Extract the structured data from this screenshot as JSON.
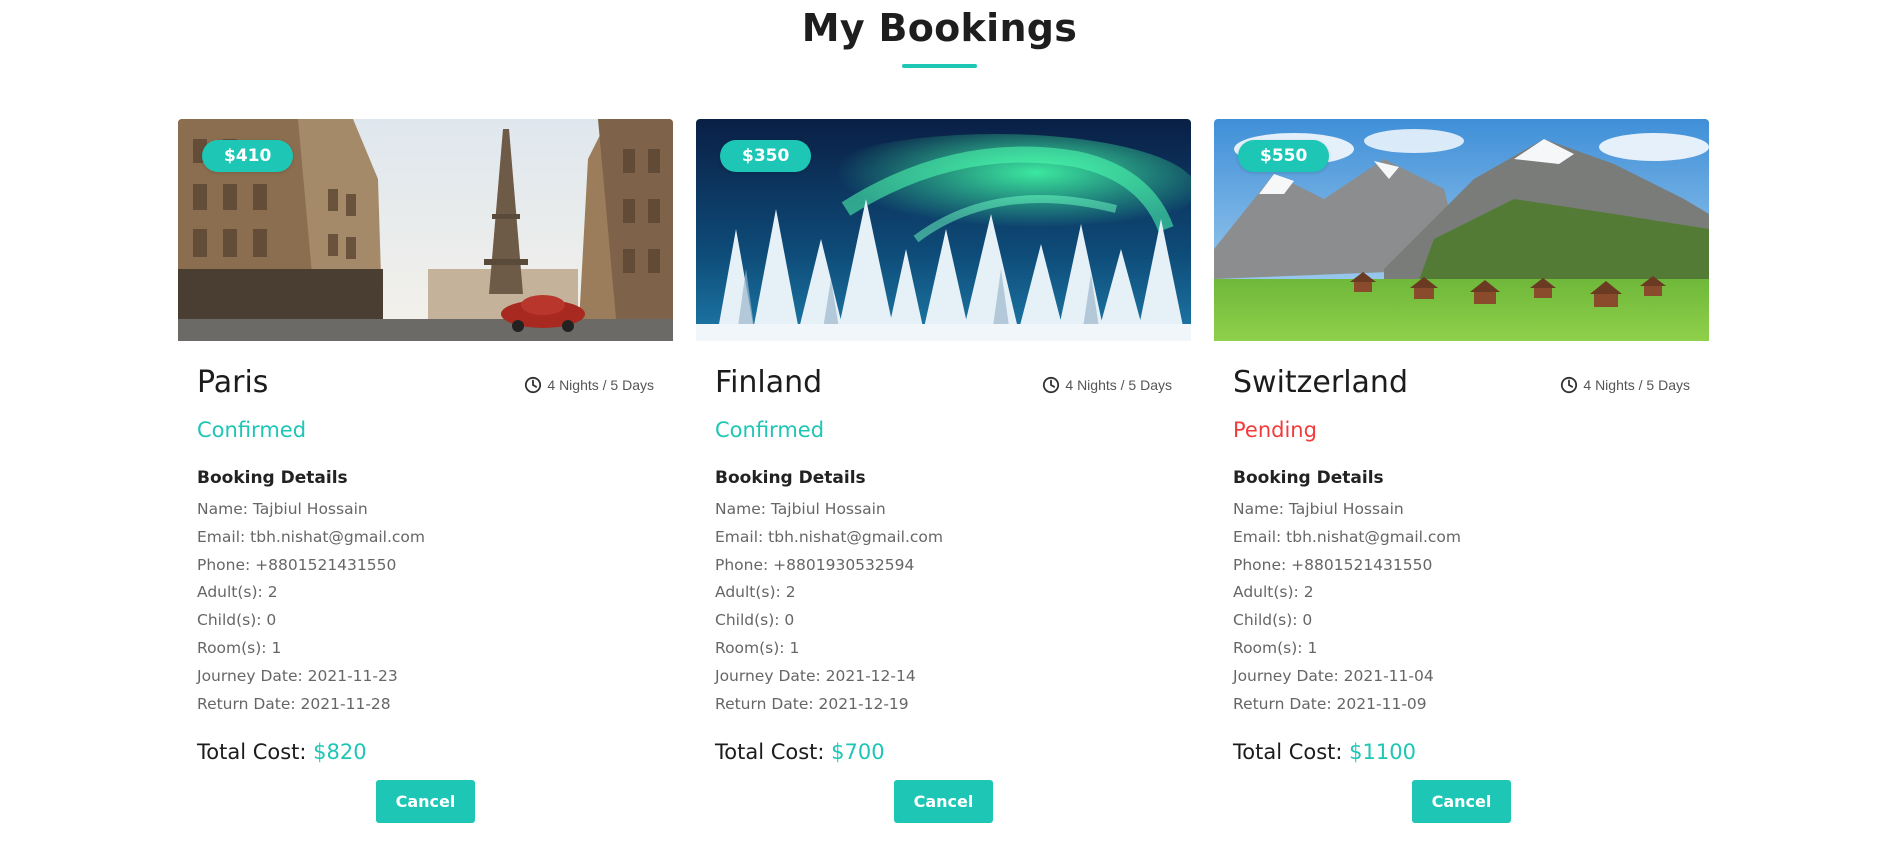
{
  "page": {
    "title": "My Bookings"
  },
  "colors": {
    "accent": "#1ec6b6",
    "pending": "#f23b3b"
  },
  "bookings": [
    {
      "price": "$410",
      "destination": "Paris",
      "duration": "4 Nights / 5 Days",
      "status": "Confirmed",
      "details_heading": "Booking Details",
      "name": "Name: Tajbiul Hossain",
      "email": "Email: tbh.nishat@gmail.com",
      "phone": "Phone: +8801521431550",
      "adults": "Adult(s): 2",
      "children": "Child(s): 0",
      "rooms": "Room(s): 1",
      "journey": "Journey Date: 2021-11-23",
      "return": "Return Date: 2021-11-28",
      "total_label": "Total Cost:",
      "total_value": "$820",
      "cancel_label": "Cancel"
    },
    {
      "price": "$350",
      "destination": "Finland",
      "duration": "4 Nights / 5 Days",
      "status": "Confirmed",
      "details_heading": "Booking Details",
      "name": "Name: Tajbiul Hossain",
      "email": "Email: tbh.nishat@gmail.com",
      "phone": "Phone: +8801930532594",
      "adults": "Adult(s): 2",
      "children": "Child(s): 0",
      "rooms": "Room(s): 1",
      "journey": "Journey Date: 2021-12-14",
      "return": "Return Date: 2021-12-19",
      "total_label": "Total Cost:",
      "total_value": "$700",
      "cancel_label": "Cancel"
    },
    {
      "price": "$550",
      "destination": "Switzerland",
      "duration": "4 Nights / 5 Days",
      "status": "Pending",
      "details_heading": "Booking Details",
      "name": "Name: Tajbiul Hossain",
      "email": "Email: tbh.nishat@gmail.com",
      "phone": "Phone: +8801521431550",
      "adults": "Adult(s): 2",
      "children": "Child(s): 0",
      "rooms": "Room(s): 1",
      "journey": "Journey Date: 2021-11-04",
      "return": "Return Date: 2021-11-09",
      "total_label": "Total Cost:",
      "total_value": "$1100",
      "cancel_label": "Cancel"
    }
  ]
}
